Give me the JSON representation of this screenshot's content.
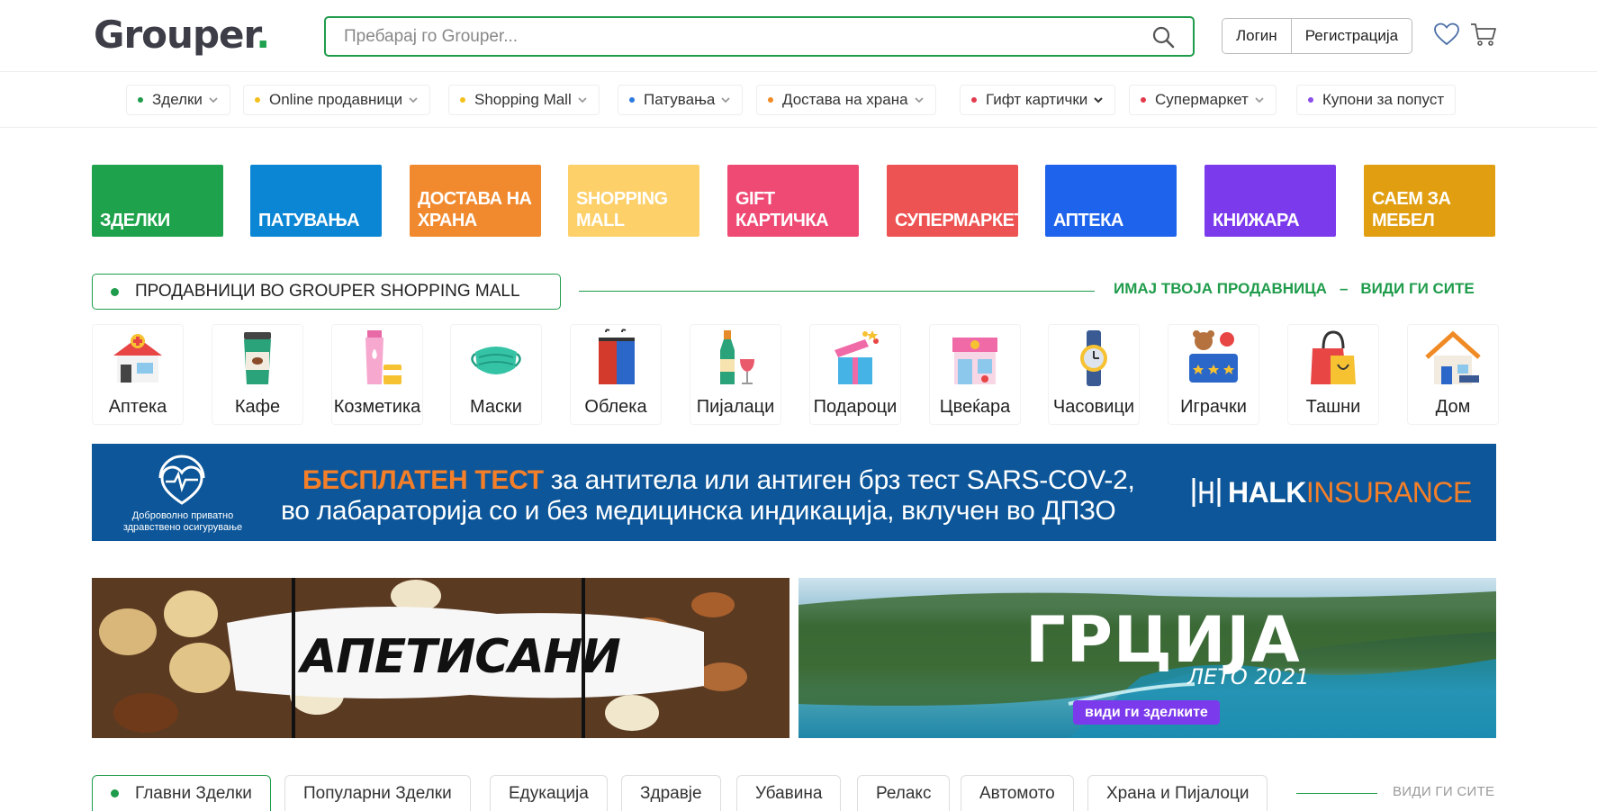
{
  "header": {
    "logo_text": "Grouper",
    "logo_dot": ".",
    "search_placeholder": "Пребарај го Grouper...",
    "login_label": "Логин",
    "register_label": "Регистрација"
  },
  "nav": {
    "items": [
      {
        "label": "Зделки",
        "color": "#1f9c4b"
      },
      {
        "label": "Online продавници",
        "color": "#f4c01e"
      },
      {
        "label": "Shopping Mall",
        "color": "#f4c01e"
      },
      {
        "label": "Патувања",
        "color": "#2d7be0"
      },
      {
        "label": "Достава на храна",
        "color": "#f08a24"
      },
      {
        "label": "Гифт картички",
        "color": "#e23b4c"
      },
      {
        "label": "Супермаркет",
        "color": "#e23b4c"
      },
      {
        "label": "Купони за попуст",
        "color": "#8a4fe8"
      }
    ]
  },
  "tiles": [
    {
      "label": "ЗДЕЛКИ",
      "color": "#1ea34c"
    },
    {
      "label": "ПАТУВАЊА",
      "color": "#0b86d4"
    },
    {
      "label": "ДОСТАВА НА\nХРАНА",
      "color": "#f18a2f"
    },
    {
      "label": "SHOPPING\nMALL",
      "color": "#fdd06a"
    },
    {
      "label": "GIFT\nКАРТИЧКА",
      "color": "#ee4a74"
    },
    {
      "label": "СУПЕРМАРКЕТ",
      "color": "#ee5353"
    },
    {
      "label": "АПТЕКА",
      "color": "#1e63eb"
    },
    {
      "label": "КНИЖАРА",
      "color": "#7c3aed"
    },
    {
      "label": "САЕМ ЗА\nМЕБЕЛ",
      "color": "#e19e10"
    }
  ],
  "shops": {
    "title": "ПРОДАВНИЦИ ВО GROUPER SHOPPING MALL",
    "link_own": "ИМАЈ ТВОЈА ПРОДАВНИЦА",
    "separator": "–",
    "link_all": "ВИДИ ГИ СИТЕ",
    "accent": "#1f9c4b"
  },
  "categories": [
    {
      "label": "Аптека",
      "icon": "pharmacy-icon"
    },
    {
      "label": "Кафе",
      "icon": "coffee-cup-icon"
    },
    {
      "label": "Козметика",
      "icon": "cosmetics-icon"
    },
    {
      "label": "Маски",
      "icon": "face-mask-icon"
    },
    {
      "label": "Облека",
      "icon": "clothing-icon"
    },
    {
      "label": "Пијалаци",
      "icon": "drinks-icon"
    },
    {
      "label": "Подароци",
      "icon": "gift-icon"
    },
    {
      "label": "Цвеќара",
      "icon": "flower-shop-icon"
    },
    {
      "label": "Часовици",
      "icon": "watch-icon"
    },
    {
      "label": "Играчки",
      "icon": "toys-icon"
    },
    {
      "label": "Ташни",
      "icon": "handbag-icon"
    },
    {
      "label": "Дом",
      "icon": "house-icon"
    }
  ],
  "banner": {
    "highlight": "БЕСПЛАТЕН ТЕСТ",
    "line1_rest": " за антитела или антиген брз тест SARS-COV-2,",
    "line2": "во лабараторија со и без медицинска индикација, вклучен во ДПЗО",
    "emblem_caption": "Доброволно приватно здравствено осигурување",
    "brand_halk": "HALK",
    "brand_insurance": "INSURANCE"
  },
  "promos": {
    "nuts_text": "АПЕТИСАНИ",
    "greece_title": "ГРЦИЈА",
    "greece_sub": "ЛЕТО 2021",
    "greece_btn": "види ги зделките"
  },
  "tabs": {
    "items": [
      "Главни Зделки",
      "Популарни Зделки",
      "Едукација",
      "Здравје",
      "Убавина",
      "Релакс",
      "Автомото",
      "Храна и Пијалоци"
    ],
    "see_all": "ВИДИ ГИ СИТЕ"
  }
}
